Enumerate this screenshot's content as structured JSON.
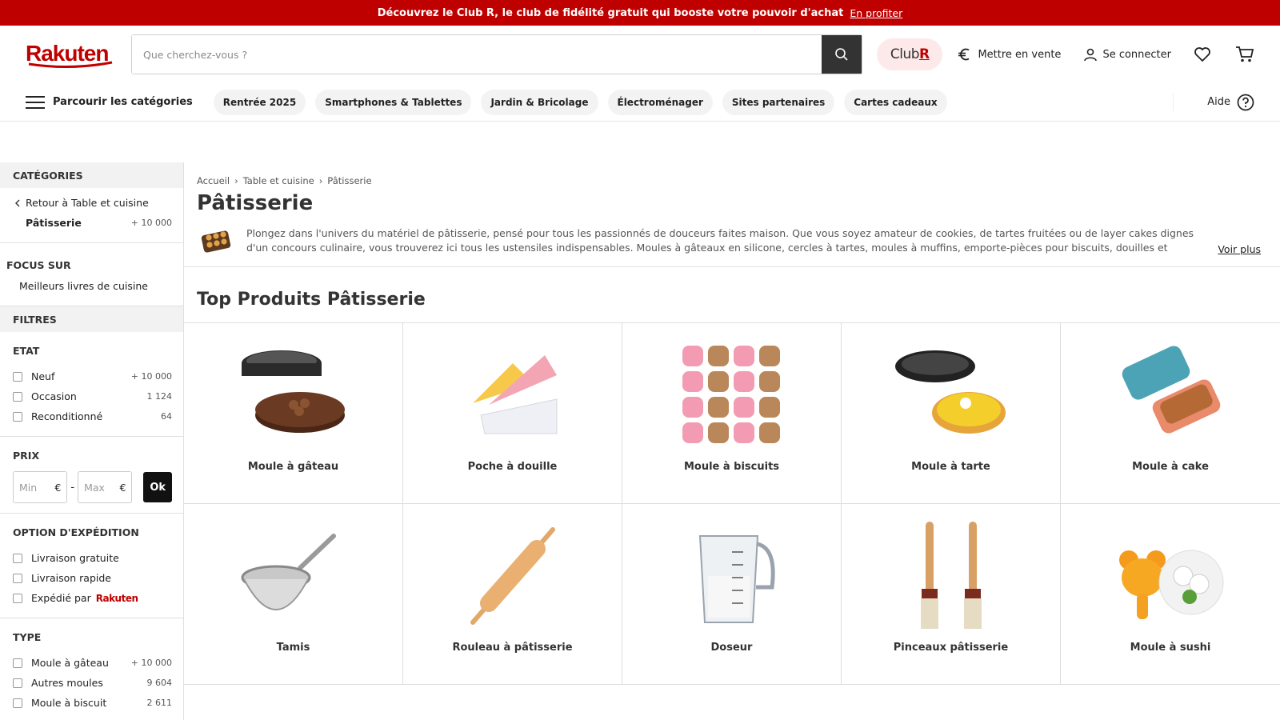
{
  "banner": {
    "text": "Découvrez le Club R, le club de fidélité gratuit qui booste votre pouvoir d'achat",
    "link": "En profiter"
  },
  "header": {
    "logo": "Rakuten",
    "search_placeholder": "Que cherchez-vous ?",
    "clubr_text": "Club",
    "clubr_letter": "R",
    "sell": "Mettre en vente",
    "login": "Se connecter"
  },
  "nav": {
    "browse": "Parcourir les catégories",
    "pills": [
      "Rentrée 2025",
      "Smartphones & Tablettes",
      "Jardin & Bricolage",
      "Électroménager",
      "Sites partenaires",
      "Cartes cadeaux"
    ],
    "help": "Aide"
  },
  "sidebar": {
    "categories_title": "CATÉGORIES",
    "back": "Retour à Table et cuisine",
    "current": "Pâtisserie",
    "current_count": "+ 10 000",
    "focus_title": "FOCUS SUR",
    "focus_item": "Meilleurs livres de cuisine",
    "filters_title": "FILTRES",
    "etat_title": "ETAT",
    "etat": [
      {
        "label": "Neuf",
        "count": "+ 10 000"
      },
      {
        "label": "Occasion",
        "count": "1 124"
      },
      {
        "label": "Reconditionné",
        "count": "64"
      }
    ],
    "prix_title": "PRIX",
    "min": "Min",
    "max": "Max",
    "currency": "€",
    "ok": "Ok",
    "ship_title": "OPTION D'EXPÉDITION",
    "ship": [
      "Livraison gratuite",
      "Livraison rapide",
      "Expédié par"
    ],
    "ship_brand": "Rakuten",
    "type_title": "TYPE",
    "types": [
      {
        "label": "Moule à gâteau",
        "count": "+ 10 000"
      },
      {
        "label": "Autres moules",
        "count": "9 604"
      },
      {
        "label": "Moule à biscuit",
        "count": "2 611"
      }
    ]
  },
  "main": {
    "crumbs": [
      "Accueil",
      "Table et cuisine",
      "Pâtisserie"
    ],
    "title": "Pâtisserie",
    "description": "Plongez dans l'univers du matériel de pâtisserie, pensé pour tous les passionnés de douceurs faites maison. Que vous soyez amateur de cookies, de tartes fruitées ou de layer cakes dignes d'un concours culinaire, vous trouverez ici tous les ustensiles indispensables. Moules à gâteaux en silicone, cercles à tartes, moules à muffins, emporte-pièces pour biscuits, douilles et poches réutilisables, pinceaux",
    "more": "Voir plus",
    "top_title": "Top Produits Pâtisserie",
    "products": [
      "Moule à gâteau",
      "Poche à douille",
      "Moule à biscuits",
      "Moule à tarte",
      "Moule à cake",
      "Tamis",
      "Rouleau à pâtisserie",
      "Doseur",
      "Pinceaux pâtisserie",
      "Moule à sushi"
    ]
  },
  "colors": {
    "brand": "#bf0000",
    "dark": "#333333"
  }
}
